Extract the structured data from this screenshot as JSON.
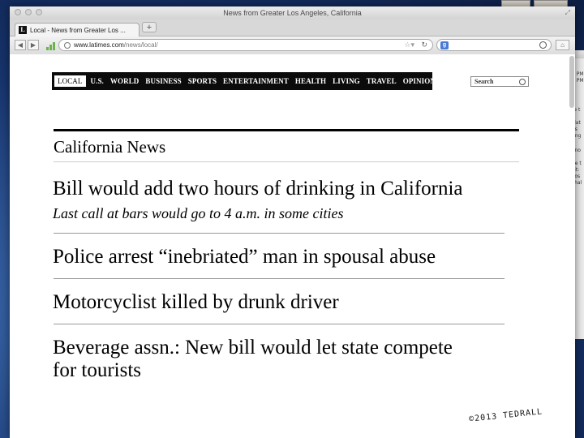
{
  "window": {
    "title": "News from Greater Los Angeles, California"
  },
  "tab": {
    "title": "Local - News from Greater Los ...",
    "favicon": "L"
  },
  "url": {
    "host": "www.latimes.com",
    "path": "/news/local/"
  },
  "search_engine": {
    "icon": "google-icon",
    "letter": "g"
  },
  "site_nav": {
    "items": [
      {
        "label": "LOCAL"
      },
      {
        "label": "U.S."
      },
      {
        "label": "WORLD"
      },
      {
        "label": "BUSINESS"
      },
      {
        "label": "SPORTS"
      },
      {
        "label": "ENTERTAINMENT"
      },
      {
        "label": "HEALTH"
      },
      {
        "label": "LIVING"
      },
      {
        "label": "TRAVEL"
      },
      {
        "label": "OPINION"
      }
    ],
    "search_label": "Search"
  },
  "section": {
    "title": "California News"
  },
  "stories": [
    {
      "headline": "Bill would add two hours of drinking in California",
      "deck": "Last call at bars would go to 4 a.m. in some cities"
    },
    {
      "headline": "Police arrest “inebriated” man in spousal abuse"
    },
    {
      "headline": "Motorcyclist killed by drunk driver"
    },
    {
      "headline_line1": "Beverage assn.:  New bill would let state compete",
      "headline_line2": "for tourists"
    }
  ],
  "signature": "©2013 TEDRALL",
  "background_window": {
    "lines": [
      "K",
      "4 PM",
      "4 PM",
      "te t",
      "slat",
      "as",
      "eng",
      "kno",
      "he t",
      "sit:",
      "ilos",
      "shal"
    ]
  }
}
